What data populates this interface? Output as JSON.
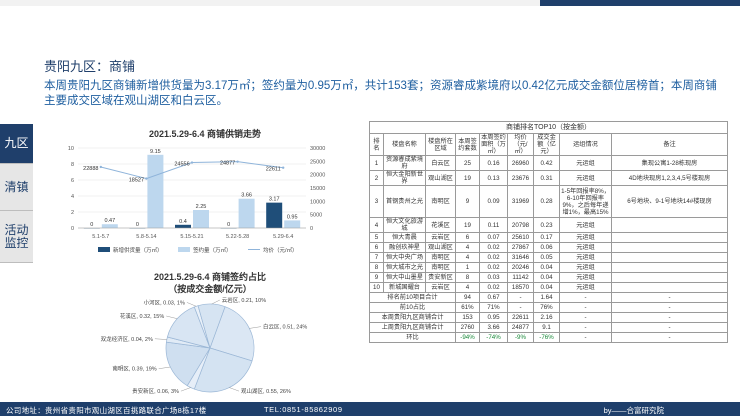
{
  "header": {
    "section_title": "贵阳九区：商铺"
  },
  "summary": "本周贵阳九区商铺新增供货量为3.17万㎡；签约量为0.95万㎡，共计153套；资源睿成紫境府以0.42亿元成交金额位居榜首；本周商铺主要成交区域在观山湖区和白云区。",
  "sidebar": {
    "tabs": [
      "九区",
      "清镇",
      "活动监控"
    ]
  },
  "colors": {
    "navy": "#1f3f6b",
    "supply_bar": "#1f4e79",
    "sign_bar": "#bdd7ee",
    "price_line": "#8fb4da"
  },
  "chart_data": [
    {
      "type": "bar",
      "title": "2021.5.29-6.4  商铺供销走势",
      "categories": [
        "5.1-5.7",
        "5.8-5.14",
        "5.15-5.21",
        "5.22-5.28",
        "5.29-6.4"
      ],
      "series": [
        {
          "name": "新增供货量（万㎡）",
          "values": [
            0,
            0,
            0.4,
            0,
            3.17
          ],
          "axis": "left"
        },
        {
          "name": "签约量（万㎡）",
          "values": [
            0.47,
            9.15,
            2.25,
            3.66,
            0.95
          ],
          "axis": "left"
        },
        {
          "name": "均价（元/㎡）",
          "values": [
            22888,
            18527,
            24556,
            24877,
            22611
          ],
          "axis": "right",
          "type": "line"
        }
      ],
      "y_left": {
        "ticks": [
          "0",
          "2",
          "4",
          "6",
          "8",
          "10"
        ],
        "ylim": [
          0,
          10
        ]
      },
      "y_right": {
        "ticks": [
          "0",
          "5000",
          "10000",
          "15000",
          "20000",
          "25000",
          "30000"
        ],
        "ylim": [
          0,
          30000
        ]
      },
      "legend_position": "bottom"
    },
    {
      "type": "pie",
      "title": "2021.5.29-6.4  商铺签约占比",
      "subtitle": "（按成交金额/亿元）",
      "slices": [
        {
          "label": "白云区, 0.51, 24%",
          "value": 0.51
        },
        {
          "label": "观山湖区, 0.55, 26%",
          "value": 0.55
        },
        {
          "label": "贵安新区, 0.06, 3%",
          "value": 0.06
        },
        {
          "label": "南明区, 0.39, 19%",
          "value": 0.39
        },
        {
          "label": "双龙经济区, 0.04, 2%",
          "value": 0.04
        },
        {
          "label": "花溪区, 0.32, 15%",
          "value": 0.32
        },
        {
          "label": "小河区, 0.03, 1%",
          "value": 0.03
        },
        {
          "label": "云岩区, 0.21, 10%",
          "value": 0.21
        }
      ]
    }
  ],
  "table": {
    "title": "商铺排名TOP10（按金额）",
    "headers": [
      "排名",
      "楼盘名称",
      "楼盘所在区域",
      "本周签约套数",
      "本周签约面积（万㎡）",
      "均价（元/㎡）",
      "成交金额（亿元）",
      "运组情况",
      "备注"
    ],
    "rows": [
      [
        "1",
        "资源睿成紫境府",
        "白云区",
        "25",
        "0.16",
        "26960",
        "0.42",
        "元运组",
        "集现公寓1-28栋现房"
      ],
      [
        "2",
        "恒大金阳新世界",
        "观山湖区",
        "19",
        "0.13",
        "23676",
        "0.31",
        "元运组",
        "4D地块现房1,2,3,4,5号楼现房"
      ],
      [
        "3",
        "首钢贵州之光",
        "南明区",
        "9",
        "0.09",
        "31969",
        "0.28",
        "1-5年回报率8%，6-10年回报率9%，之后每年递增1%，最高15%",
        "6号地块、9-1号地块14#楼现房"
      ],
      [
        "4",
        "恒大文化旅游城",
        "花溪区",
        "19",
        "0.11",
        "20798",
        "0.23",
        "元运组",
        ""
      ],
      [
        "5",
        "恒大青晨",
        "云岩区",
        "6",
        "0.07",
        "25610",
        "0.17",
        "元运组",
        ""
      ],
      [
        "6",
        "融创玖神星",
        "观山湖区",
        "4",
        "0.02",
        "27867",
        "0.06",
        "元运组",
        ""
      ],
      [
        "7",
        "恒大中央广场",
        "南明区",
        "4",
        "0.02",
        "31646",
        "0.05",
        "元运组",
        ""
      ],
      [
        "8",
        "恒大城市之光",
        "南明区",
        "1",
        "0.02",
        "20246",
        "0.04",
        "元运组",
        ""
      ],
      [
        "9",
        "恒大中山墨星",
        "贵安新区",
        "8",
        "0.03",
        "11142",
        "0.04",
        "元运组",
        ""
      ],
      [
        "10",
        "新城国耀台",
        "云岩区",
        "4",
        "0.02",
        "18570",
        "0.04",
        "元运组",
        ""
      ]
    ],
    "footer_rows": [
      [
        "排名前10项目合计",
        "94",
        "0.67",
        "-",
        "1.64",
        "-",
        "-"
      ],
      [
        "前10占比",
        "61%",
        "71%",
        "-",
        "76%",
        "-",
        "-"
      ],
      [
        "本周贵阳九区商铺合计",
        "153",
        "0.95",
        "22611",
        "2.16",
        "-",
        "-"
      ],
      [
        "上周贵阳九区商铺合计",
        "2760",
        "3.66",
        "24877",
        "9.1",
        "-",
        "-"
      ],
      [
        "环比",
        "-94%",
        "-74%",
        "-9%",
        "-76%",
        "-",
        "-"
      ]
    ]
  },
  "footer": {
    "address": "公司地址：贵州省贵阳市观山湖区百挑路联合广场8栋17楼",
    "tel": "TEL:0851-85862909",
    "brand": "by——合富研究院"
  }
}
